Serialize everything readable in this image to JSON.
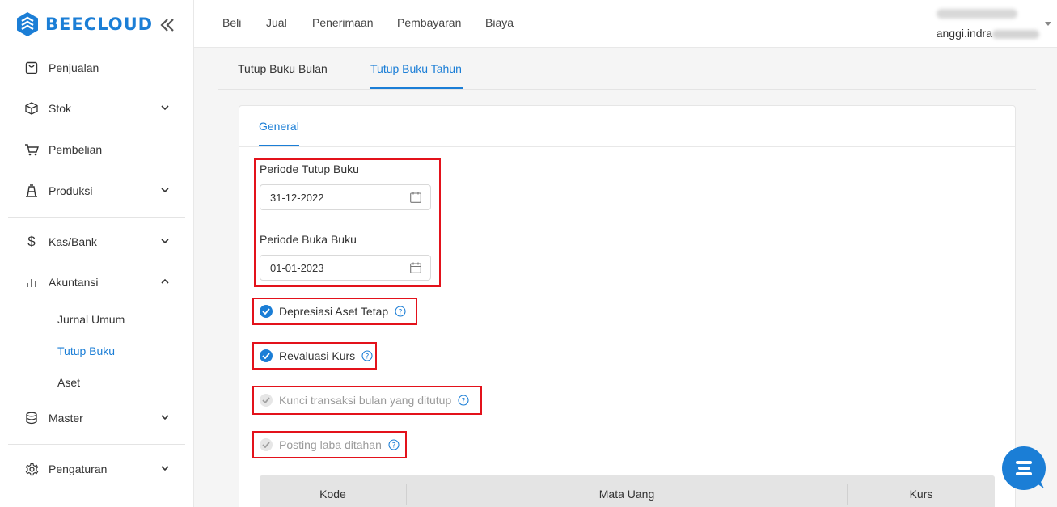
{
  "brand": {
    "name": "BEECLOUD"
  },
  "sidebar": {
    "items": [
      {
        "label": "Penjualan",
        "icon": "receipt-icon"
      },
      {
        "label": "Stok",
        "icon": "box-icon"
      },
      {
        "label": "Pembelian",
        "icon": "cart-icon"
      },
      {
        "label": "Produksi",
        "icon": "factory-icon"
      },
      {
        "label": "Kas/Bank",
        "icon": "dollar-icon"
      },
      {
        "label": "Akuntansi",
        "icon": "bar-chart-icon"
      },
      {
        "label": "Master",
        "icon": "database-icon"
      },
      {
        "label": "Pengaturan",
        "icon": "gear-icon"
      }
    ],
    "akuntansi_sub": [
      {
        "label": "Jurnal Umum"
      },
      {
        "label": "Tutup Buku"
      },
      {
        "label": "Aset"
      }
    ],
    "active_sub": "Tutup Buku"
  },
  "topnav": {
    "items": [
      {
        "label": "Beli"
      },
      {
        "label": "Jual"
      },
      {
        "label": "Penerimaan"
      },
      {
        "label": "Pembayaran"
      },
      {
        "label": "Biaya"
      }
    ]
  },
  "user": {
    "email_prefix": "anggi.indra"
  },
  "subtabs": [
    {
      "label": "Tutup Buku Bulan"
    },
    {
      "label": "Tutup Buku Tahun"
    }
  ],
  "card": {
    "tab": "General",
    "close_period": {
      "label": "Periode Tutup Buku",
      "value": "31-12-2022"
    },
    "open_period": {
      "label": "Periode Buka Buku",
      "value": "01-01-2023"
    },
    "options": [
      {
        "label": "Depresiasi Aset Tetap",
        "checked": true,
        "disabled": false
      },
      {
        "label": "Revaluasi Kurs",
        "checked": true,
        "disabled": false
      },
      {
        "label": "Kunci transaksi bulan yang ditutup",
        "checked": true,
        "disabled": true
      },
      {
        "label": "Posting laba ditahan",
        "checked": true,
        "disabled": true
      }
    ],
    "table": {
      "columns": [
        "Kode",
        "Mata Uang",
        "Kurs"
      ]
    }
  },
  "colors": {
    "accent": "#1b7ed6",
    "highlight": "#e3121b",
    "disabled": "#9a9a9a"
  }
}
